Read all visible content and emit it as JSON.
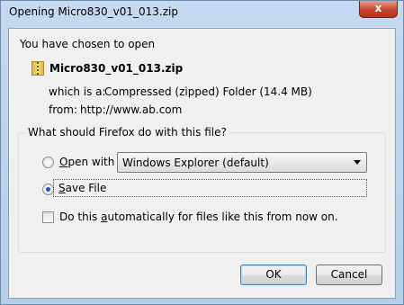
{
  "window": {
    "title": "Opening Micro830_v01_013.zip",
    "close_label": "x"
  },
  "dialog": {
    "intro": "You have chosen to open",
    "file_name": "Micro830_v01_013.zip",
    "which_is_label": "which is a:",
    "which_is_value": "Compressed (zipped) Folder (14.4 MB)",
    "from_label": "from:",
    "from_value": "http://www.ab.com"
  },
  "group": {
    "legend": "What should Firefox do with this file?",
    "open_with_prefix": "O",
    "open_with_rest": "pen with",
    "open_with_app": "Windows Explorer (default)",
    "save_prefix": "S",
    "save_rest": "ave File",
    "selected_option": "Save File",
    "auto_prefix": "Do this ",
    "auto_underlined": "a",
    "auto_rest": "utomatically for files like this from now on.",
    "auto_checked": false
  },
  "buttons": {
    "ok": "OK",
    "cancel": "Cancel"
  },
  "icons": {
    "file": "zip-file-icon",
    "close": "close-icon",
    "dropdown": "chevron-down-icon"
  }
}
